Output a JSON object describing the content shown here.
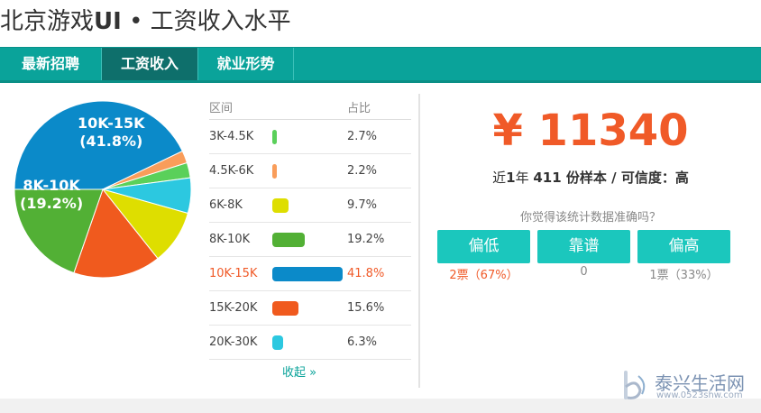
{
  "header": {
    "title_pre": "北京游戏",
    "title_bold": "UI",
    "title_post": " • 工资收入水平"
  },
  "tabs": [
    {
      "label": "最新招聘",
      "active": false
    },
    {
      "label": "工资收入",
      "active": true
    },
    {
      "label": "就业形势",
      "active": false
    }
  ],
  "distribution": {
    "col_range": "区间",
    "col_ratio": "占比",
    "rows": [
      {
        "range": "3K-4.5K",
        "ratio": "2.7%",
        "value": 2.7,
        "color": "#5ad05a"
      },
      {
        "range": "4.5K-6K",
        "ratio": "2.2%",
        "value": 2.2,
        "color": "#f99d5a"
      },
      {
        "range": "6K-8K",
        "ratio": "9.7%",
        "value": 9.7,
        "color": "#dede00"
      },
      {
        "range": "8K-10K",
        "ratio": "19.2%",
        "value": 19.2,
        "color": "#52b035"
      },
      {
        "range": "10K-15K",
        "ratio": "41.8%",
        "value": 41.8,
        "color": "#0b8ac9"
      },
      {
        "range": "15K-20K",
        "ratio": "15.6%",
        "value": 15.6,
        "color": "#f05a1e"
      },
      {
        "range": "20K-30K",
        "ratio": "6.3%",
        "value": 6.3,
        "color": "#2cc8e0"
      }
    ],
    "collapse_label": "收起 »"
  },
  "pie_labels": {
    "big": {
      "line1": "10K-15K",
      "line2": "(41.8%)"
    },
    "second": {
      "line1": "8K-10K",
      "line2": "(19.2%)"
    }
  },
  "chart_data": {
    "type": "pie",
    "categories": [
      "3K-4.5K",
      "4.5K-6K",
      "6K-8K",
      "8K-10K",
      "10K-15K",
      "15K-20K",
      "20K-30K"
    ],
    "values": [
      2.7,
      2.2,
      9.7,
      19.2,
      41.8,
      15.6,
      6.3
    ]
  },
  "summary": {
    "salary": "¥ 11340",
    "sample_pre": "近",
    "sample_years": "1",
    "sample_mid": "年 ",
    "sample_count": "411",
    "sample_post": " 份样本 / 可信度：",
    "credibility": "高",
    "question": "你觉得该统计数据准确吗？",
    "buttons": [
      {
        "label": "偏低",
        "votes": "2票（67%）",
        "highlight": true
      },
      {
        "label": "靠谱",
        "votes": "0",
        "highlight": false
      },
      {
        "label": "偏高",
        "votes": "1票（33%）",
        "highlight": false
      }
    ]
  },
  "watermark": {
    "name": "泰兴生活网",
    "url": "www.0523shw.com"
  },
  "colors": {
    "accent": "#0aa39a",
    "salary": "#f05a28"
  }
}
